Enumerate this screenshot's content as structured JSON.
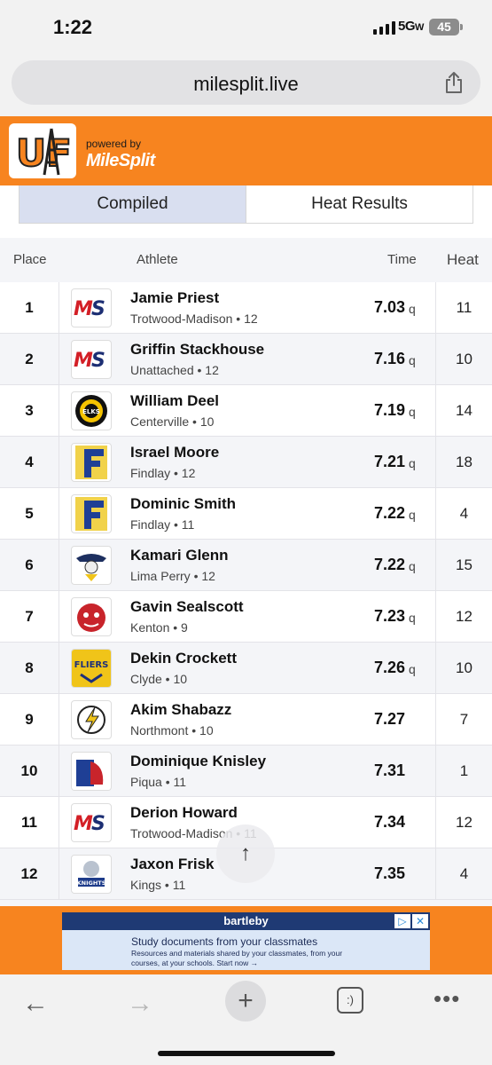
{
  "status_bar": {
    "time": "1:22",
    "network": "5G",
    "network_suffix": "W",
    "battery": "45"
  },
  "browser": {
    "url": "milesplit.live",
    "share_icon": "share-icon"
  },
  "brand": {
    "logo_text": "UF",
    "powered_by": "powered by",
    "milesplit": "MileSplit"
  },
  "tabs": [
    {
      "label": "Compiled",
      "active": true
    },
    {
      "label": "Heat Results",
      "active": false
    }
  ],
  "table": {
    "headers": {
      "place": "Place",
      "athlete": "Athlete",
      "time": "Time",
      "heat": "Heat"
    },
    "rows": [
      {
        "place": "1",
        "name": "Jamie Priest",
        "school": "Trotwood-Madison • 12",
        "time": "7.03",
        "q": "q",
        "heat": "11",
        "logo": "MS"
      },
      {
        "place": "2",
        "name": "Griffin Stackhouse",
        "school": "Unattached • 12",
        "time": "7.16",
        "q": "q",
        "heat": "10",
        "logo": "MS"
      },
      {
        "place": "3",
        "name": "William Deel",
        "school": "Centerville • 10",
        "time": "7.19",
        "q": "q",
        "heat": "14",
        "logo": "ELKS"
      },
      {
        "place": "4",
        "name": "Israel Moore",
        "school": "Findlay • 12",
        "time": "7.21",
        "q": "q",
        "heat": "18",
        "logo": "F"
      },
      {
        "place": "5",
        "name": "Dominic Smith",
        "school": "Findlay • 11",
        "time": "7.22",
        "q": "q",
        "heat": "4",
        "logo": "F"
      },
      {
        "place": "6",
        "name": "Kamari Glenn",
        "school": "Lima Perry • 12",
        "time": "7.22",
        "q": "q",
        "heat": "15",
        "logo": ""
      },
      {
        "place": "7",
        "name": "Gavin Sealscott",
        "school": "Kenton • 9",
        "time": "7.23",
        "q": "q",
        "heat": "12",
        "logo": ""
      },
      {
        "place": "8",
        "name": "Dekin Crockett",
        "school": "Clyde • 10",
        "time": "7.26",
        "q": "q",
        "heat": "10",
        "logo": "FLIERS"
      },
      {
        "place": "9",
        "name": "Akim Shabazz",
        "school": "Northmont • 10",
        "time": "7.27",
        "q": "",
        "heat": "7",
        "logo": ""
      },
      {
        "place": "10",
        "name": "Dominique Knisley",
        "school": "Piqua • 11",
        "time": "7.31",
        "q": "",
        "heat": "1",
        "logo": ""
      },
      {
        "place": "11",
        "name": "Derion Howard",
        "school": "Trotwood-Madison • 11",
        "time": "7.34",
        "q": "",
        "heat": "12",
        "logo": "MS"
      },
      {
        "place": "12",
        "name": "Jaxon Frisk",
        "school": "Kings • 11",
        "time": "7.35",
        "q": "",
        "heat": "4",
        "logo": "KNIGHTS"
      }
    ]
  },
  "scroll_top": "↑",
  "ad": {
    "brand": "bartleby",
    "title": "Study documents from your classmates",
    "body": "Resources and materials shared by your classmates, from your courses, at your schools. Start now →"
  },
  "bottom_bar": {
    "back": "←",
    "forward": "→",
    "new_tab": "+",
    "tabs": ":)",
    "more": "•••"
  }
}
